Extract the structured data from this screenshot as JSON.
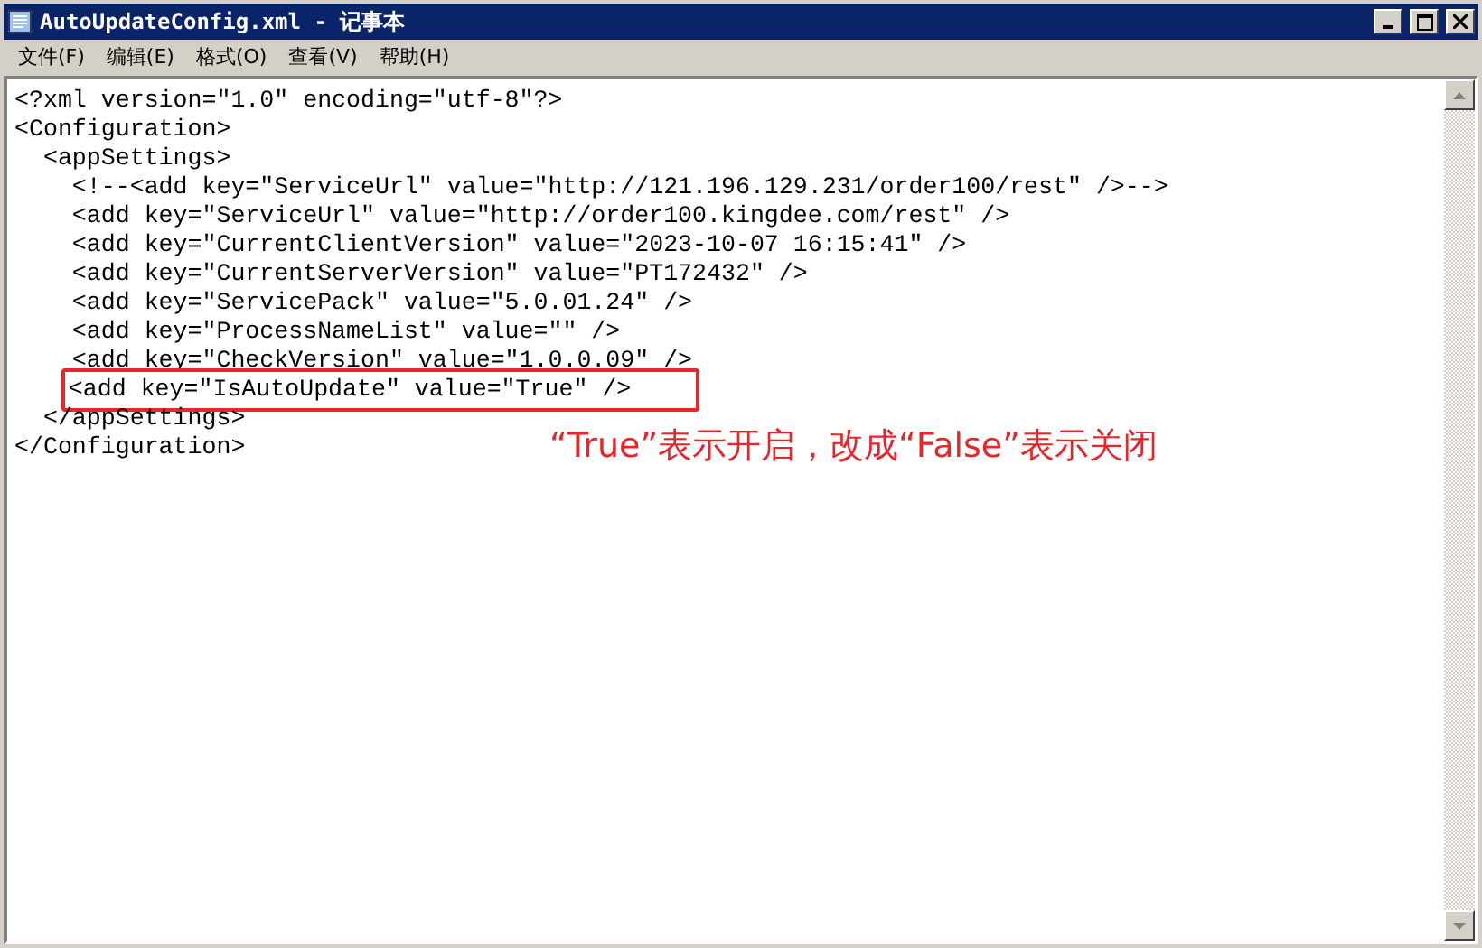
{
  "window": {
    "title": "AutoUpdateConfig.xml - 记事本"
  },
  "menu": [
    {
      "label": "文件(F)"
    },
    {
      "label": "编辑(E)"
    },
    {
      "label": "格式(O)"
    },
    {
      "label": "查看(V)"
    },
    {
      "label": "帮助(H)"
    }
  ],
  "lines": [
    {
      "text": "<?xml version=\"1.0\" encoding=\"utf-8\"?>",
      "annotated": false
    },
    {
      "text": "<Configuration>",
      "annotated": false
    },
    {
      "text": "  <appSettings>",
      "annotated": false
    },
    {
      "text": "    <!--<add key=\"ServiceUrl\" value=\"http://121.196.129.231/order100/rest\" />-->",
      "annotated": false
    },
    {
      "text": "    <add key=\"ServiceUrl\" value=\"http://order100.kingdee.com/rest\" />",
      "annotated": false
    },
    {
      "text": "    <add key=\"CurrentClientVersion\" value=\"2023-10-07 16:15:41\" />",
      "annotated": false
    },
    {
      "text": "    <add key=\"CurrentServerVersion\" value=\"PT172432\" />",
      "annotated": false
    },
    {
      "text": "    <add key=\"ServicePack\" value=\"5.0.01.24\" />",
      "annotated": false
    },
    {
      "text": "    <add key=\"ProcessNameList\" value=\"\" />",
      "annotated": false
    },
    {
      "text": "    <add key=\"CheckVersion\" value=\"1.0.0.09\" />",
      "annotated": false
    },
    {
      "text": "    <add key=\"IsAutoUpdate\" value=\"True\" />",
      "annotated": true
    },
    {
      "text": "  </appSettings>",
      "annotated": false
    },
    {
      "text": "</Configuration>",
      "annotated": false
    }
  ],
  "annotation": {
    "text": "“True”表示开启，改成“False”表示关闭"
  }
}
